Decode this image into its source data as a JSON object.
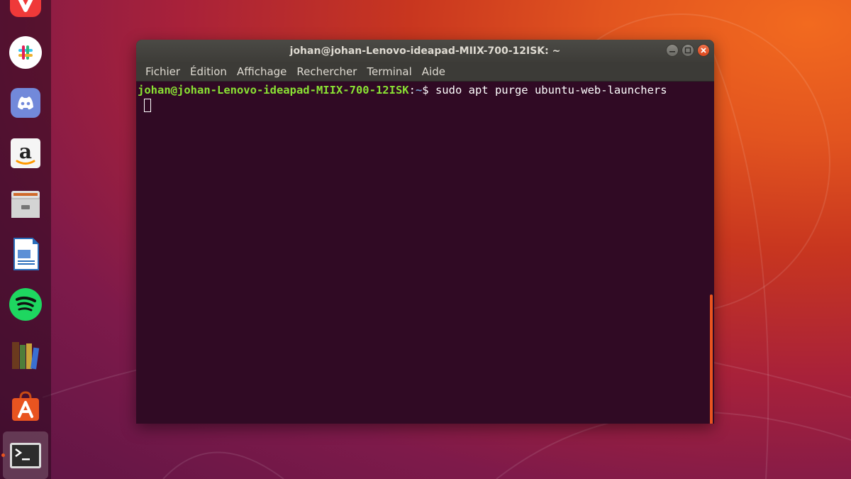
{
  "desktop": {
    "dock": [
      {
        "name": "vivaldi-icon",
        "color": "#ef3939"
      },
      {
        "name": "slack-icon",
        "color": "#ffffff"
      },
      {
        "name": "discord-icon",
        "color": "#7289da"
      },
      {
        "name": "amazon-icon",
        "color": "#ffffff"
      },
      {
        "name": "files-icon",
        "color": "#c9c9c9"
      },
      {
        "name": "libreoffice-writer-icon",
        "color": "#2a6ebb"
      },
      {
        "name": "spotify-icon",
        "color": "#1ed760"
      },
      {
        "name": "calibre-icon",
        "color": "#6b3a1e"
      },
      {
        "name": "software-center-icon",
        "color": "#e95420"
      },
      {
        "name": "terminal-icon",
        "color": "#2c2c2c"
      }
    ]
  },
  "window": {
    "title": "johan@johan-Lenovo-ideapad-MIIX-700-12ISK: ~",
    "menu": [
      "Fichier",
      "Édition",
      "Affichage",
      "Rechercher",
      "Terminal",
      "Aide"
    ]
  },
  "terminal": {
    "prompt_user": "johan@johan-Lenovo-ideapad-MIIX-700-12ISK",
    "prompt_sep": ":",
    "prompt_path": "~",
    "prompt_symbol": "$",
    "command": " sudo apt purge ubuntu-web-launchers",
    "colors": {
      "background": "#300a24",
      "user": "#8ae234",
      "path": "#729fcf",
      "scrollbar": "#e95420"
    }
  }
}
